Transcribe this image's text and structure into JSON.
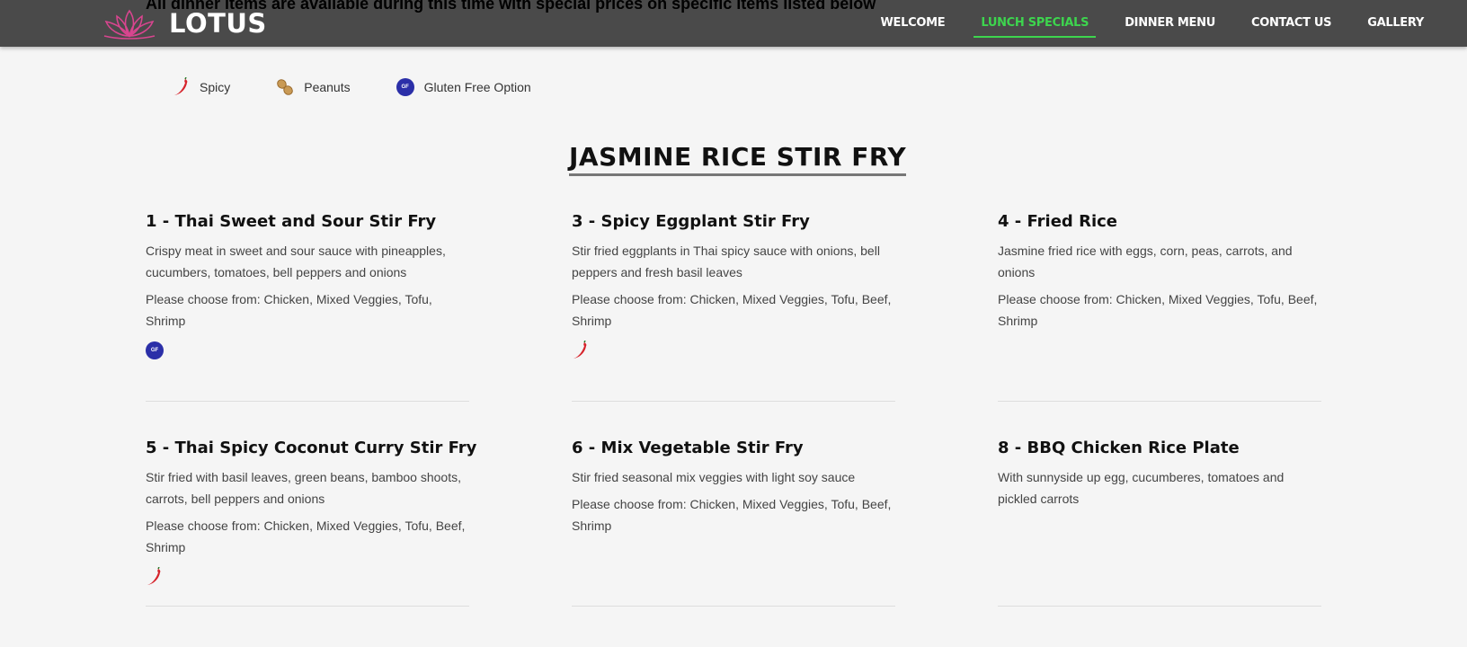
{
  "header": {
    "brand": "LOTUS",
    "overlap_text": "All dinner items are available during this time with special prices on specific items listed below",
    "nav": [
      {
        "label": "WELCOME",
        "active": false
      },
      {
        "label": "LUNCH SPECIALS",
        "active": true
      },
      {
        "label": "DINNER MENU",
        "active": false
      },
      {
        "label": "CONTACT US",
        "active": false
      },
      {
        "label": "GALLERY",
        "active": false
      }
    ]
  },
  "legend": {
    "spicy": "Spicy",
    "peanuts": "Peanuts",
    "gluten_free": "Gluten Free Option",
    "gf_badge": "GF"
  },
  "section": {
    "title": "JASMINE RICE STIR FRY"
  },
  "items": [
    {
      "title": "1 - Thai Sweet and Sour Stir Fry",
      "desc": "Crispy meat in sweet and sour sauce with pineapples, cucumbers, tomatoes, bell peppers and onions",
      "choose": "Please choose from: Chicken, Mixed Veggies, Tofu, Shrimp",
      "icon": "gluten-free-icon"
    },
    {
      "title": "3 - Spicy Eggplant Stir Fry",
      "desc": "Stir fried eggplants in Thai spicy sauce with onions, bell peppers and fresh basil leaves",
      "choose": "Please choose from: Chicken, Mixed Veggies, Tofu, Beef, Shrimp",
      "icon": "chili-pepper-icon"
    },
    {
      "title": "4 - Fried Rice",
      "desc": "Jasmine fried rice with eggs, corn, peas, carrots, and onions",
      "choose": "Please choose from: Chicken, Mixed Veggies, Tofu, Beef, Shrimp",
      "icon": ""
    },
    {
      "title": "5 - Thai Spicy Coconut Curry Stir Fry",
      "desc": "Stir fried with basil leaves, green beans, bamboo shoots, carrots, bell peppers and onions",
      "choose": "Please choose from: Chicken, Mixed Veggies, Tofu, Beef, Shrimp",
      "icon": "chili-pepper-icon"
    },
    {
      "title": "6 - Mix Vegetable Stir Fry",
      "desc": "Stir fried seasonal mix veggies with light soy sauce",
      "choose": "Please choose from: Chicken, Mixed Veggies, Tofu, Beef, Shrimp",
      "icon": ""
    },
    {
      "title": "8 - BBQ Chicken Rice Plate",
      "desc": "With sunnyside up egg, cucumberes, tomatoes and pickled carrots",
      "choose": "",
      "icon": ""
    }
  ],
  "colors": {
    "header_bg": "#4a4a4a",
    "active_nav": "#3dd54e",
    "gf_badge": "#2b2fa8",
    "chili": "#d6232b",
    "lotus": "#d8458f"
  }
}
